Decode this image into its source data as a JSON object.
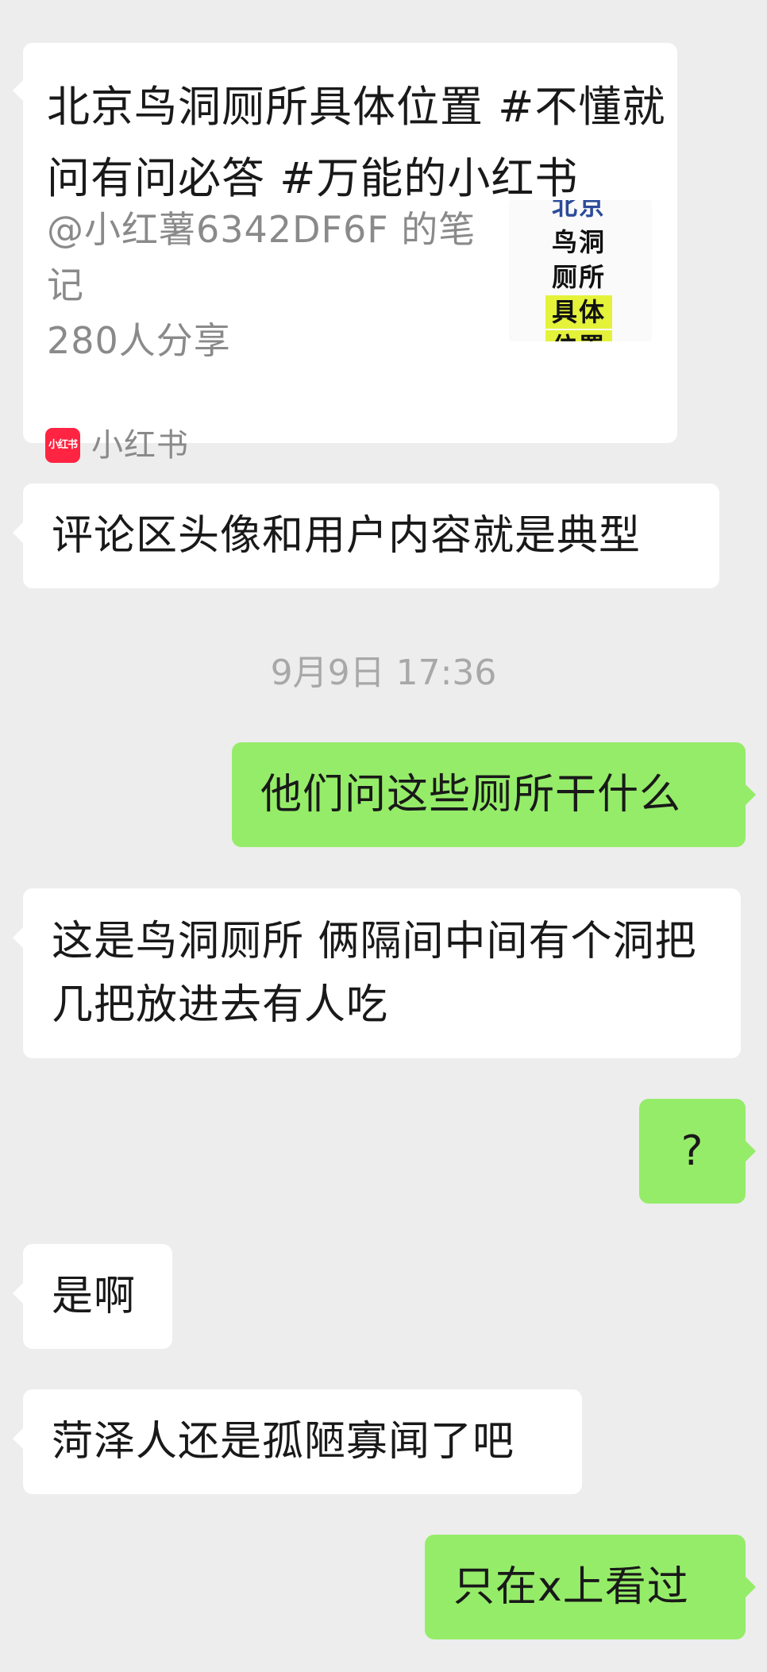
{
  "messages": {
    "card": {
      "title": "北京鸟洞厕所具体位置 #不懂就问有问必答 #万能的小红书",
      "author_note": "@小红薯6342DF6F 的笔记",
      "shares": "280人分享",
      "thumbnail_lines": [
        "北京",
        "鸟洞",
        "厕所",
        "具体",
        "位置"
      ],
      "source_logo_text": "小红书",
      "source_name": "小红书"
    },
    "m1": "评论区头像和用户内容就是典型",
    "timestamp": "9月9日 17:36",
    "m2": "他们问这些厕所干什么",
    "m3": "这是鸟洞厕所 俩隔间中间有个洞把几把放进去有人吃",
    "m4": "?",
    "m5": "是啊",
    "m6": "菏泽人还是孤陋寡闻了吧",
    "m7": "只在x上看过"
  },
  "colors": {
    "background": "#ededed",
    "incoming_bubble": "#ffffff",
    "outgoing_bubble": "#95ec69",
    "xiaohongshu_red": "#ff2442",
    "thumbnail_highlight": "#e4f23a"
  }
}
